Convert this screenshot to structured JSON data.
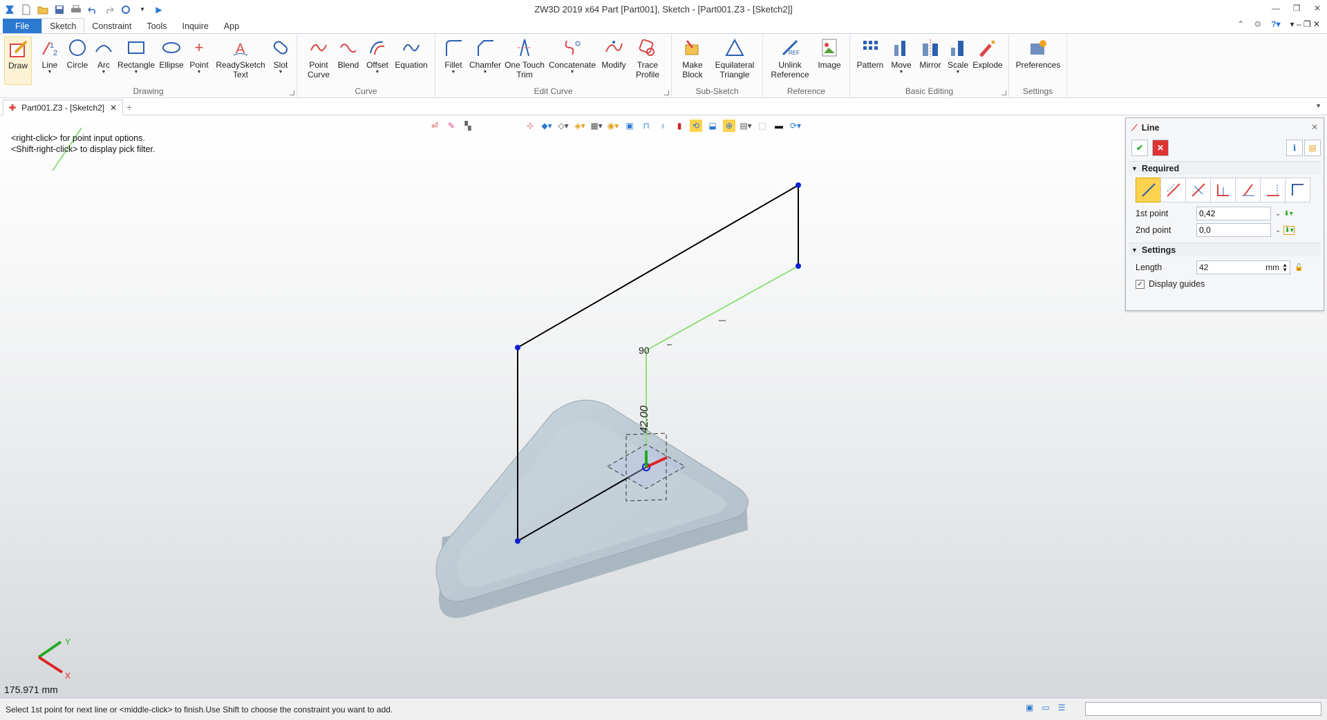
{
  "window": {
    "title": "ZW3D 2019  x64          Part [Part001],  Sketch - [Part001.Z3 - [Sketch2]]"
  },
  "menu": {
    "file": "File",
    "tabs": [
      "Sketch",
      "Constraint",
      "Tools",
      "Inquire",
      "App"
    ],
    "active_tab": "Sketch"
  },
  "ribbon": {
    "groups": {
      "drawing": "Drawing",
      "curve": "Curve",
      "edit_curve": "Edit Curve",
      "sub_sketch": "Sub-Sketch",
      "reference": "Reference",
      "basic_editing": "Basic Editing",
      "settings": "Settings"
    },
    "draw": "Draw",
    "line": "Line",
    "circle": "Circle",
    "arc": "Arc",
    "rectangle": "Rectangle",
    "ellipse": "Ellipse",
    "point": "Point",
    "readysketch_1": "ReadySketch",
    "readysketch_2": "Text",
    "slot": "Slot",
    "point_curve_1": "Point",
    "point_curve_2": "Curve",
    "blend": "Blend",
    "offset": "Offset",
    "equation": "Equation",
    "fillet": "Fillet",
    "chamfer": "Chamfer",
    "one_touch_1": "One Touch",
    "one_touch_2": "Trim",
    "concatenate": "Concatenate",
    "modify": "Modify",
    "trace_1": "Trace",
    "trace_2": "Profile",
    "make_block_1": "Make",
    "make_block_2": "Block",
    "eq_tri_1": "Equilateral",
    "eq_tri_2": "Triangle",
    "unlink_1": "Unlink",
    "unlink_2": "Reference",
    "image": "Image",
    "pattern": "Pattern",
    "move": "Move",
    "mirror": "Mirror",
    "scale": "Scale",
    "explode": "Explode",
    "preferences": "Preferences"
  },
  "doc_tab": {
    "label": "Part001.Z3 - [Sketch2]"
  },
  "viewport": {
    "hint_1": "<right-click> for point input options.",
    "hint_2": "<Shift-right-click> to display pick filter.",
    "dimension_label": "42.00",
    "angle_label": "90",
    "readout": "175.971 mm",
    "axis_x": "X",
    "axis_y": "Y"
  },
  "line_panel": {
    "title": "Line",
    "required": "Required",
    "first_point_label": "1st point",
    "first_point_value": "0,42",
    "second_point_label": "2nd point",
    "second_point_value": "0,0",
    "settings": "Settings",
    "length_label": "Length",
    "length_value": "42",
    "length_unit": "mm",
    "display_guides": "Display guides",
    "display_guides_checked": true
  },
  "status": {
    "text": "Select 1st point for next line or <middle-click> to finish.Use Shift to choose the constraint you want to add."
  },
  "colors": {
    "file_tab": "#2b79d0",
    "accent": "#fcd24f",
    "sketch_line": "#000000",
    "guide_line": "#8ee07a",
    "vertex": "#0b1fd6"
  }
}
